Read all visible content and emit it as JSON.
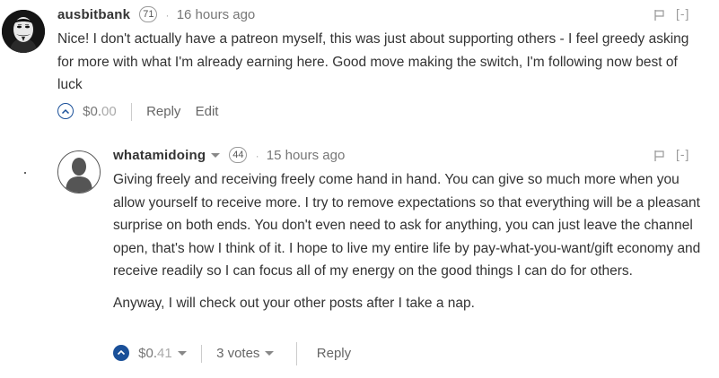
{
  "comments": [
    {
      "author": "ausbitbank",
      "reputation": "71",
      "time_ago": "16 hours ago",
      "collapse_label": "[-]",
      "paragraphs": [
        "Nice! I don't actually have a patreon myself, this was just about supporting others - I feel greedy asking for more with what I'm already earning here. Good move making the switch, I'm following now best of luck"
      ],
      "payout_dollars": "$0.",
      "payout_cents": "00",
      "reply_label": "Reply",
      "edit_label": "Edit",
      "avatar_icon": "guy-fawkes-mask-avatar",
      "voted": false
    },
    {
      "author": "whatamidoing",
      "reputation": "44",
      "time_ago": "15 hours ago",
      "collapse_label": "[-]",
      "paragraphs": [
        "Giving freely and receiving freely come hand in hand. You can give so much more when you allow yourself to receive more. I try to remove expectations so that everything will be a pleasant surprise on both ends. You don't even need to ask for anything, you can just leave the channel open, that's how I think of it. I hope to live my entire life by pay-what-you-want/gift economy and receive readily so I can focus all of my energy on the good things I can do for others.",
        "Anyway, I will check out your other posts after I take a nap."
      ],
      "payout_dollars": "$0.",
      "payout_cents": "41",
      "votes_label": "3 votes",
      "reply_label": "Reply",
      "avatar_icon": "default-user-avatar",
      "voted": true
    }
  ],
  "colors": {
    "vote_blue": "#1a5099",
    "text": "#333333",
    "muted": "#777777"
  }
}
